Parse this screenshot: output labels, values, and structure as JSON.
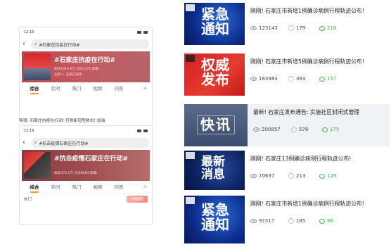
{
  "phone1": {
    "time": "12:19",
    "search": "#石家庄抗疫在行动#",
    "banner_title": "#石家庄抗疫在行动#",
    "banner_stats": "阅读1816.6万  讨论1375  详情›",
    "banner_host": "主持人: 石家庄发布",
    "tabs": [
      "综合",
      "实时",
      "热门",
      "视频",
      "问答"
    ],
    "plus": "+"
  },
  "guide_text": "导语: 石家庄抗疫在行动! 打败新冠型肺炎! 加油",
  "phone2": {
    "time": "12:19",
    "search": "#抗击疫情石家庄在行动#",
    "banner_title": "#抗击疫情石家庄在行动#",
    "banner_stats": "阅读473.1万  讨论8284  详情›",
    "tabs": [
      "综合",
      "实时",
      "热门",
      "视频",
      "问答"
    ],
    "plus": "+",
    "hot_label": "热门",
    "hot_logo": "中国国际"
  },
  "news": [
    {
      "image_text": "紧急\n通知",
      "title": "刚刚! 石家庄市新增1例确诊病例行程轨迹公布!",
      "views": "123143",
      "likes": "179",
      "comments": "218",
      "color": "blue"
    },
    {
      "image_text": "权威\n发布",
      "title": "刚刚! 石家庄市新增5例确诊病例行程轨迹公布!",
      "views": "183983",
      "likes": "383",
      "comments": "157",
      "color": "red"
    },
    {
      "image_text": "快讯",
      "title": "最新! 石家庄发布通告: 实施社区封闭式管理",
      "views": "200857",
      "likes": "578",
      "comments": "175",
      "color": "gray"
    },
    {
      "image_text": "最新\n消息",
      "title": "刚刚! 石家庄13例确诊病例行程轨迹公布!",
      "views": "70637",
      "likes": "213",
      "comments": "129",
      "color": "navy"
    },
    {
      "image_text": "紧急\n通知",
      "title": "刚刚! 石家庄市新增1例确诊病例行程轨迹公布!",
      "views": "91517",
      "likes": "185",
      "comments": "89",
      "color": "blue"
    }
  ]
}
